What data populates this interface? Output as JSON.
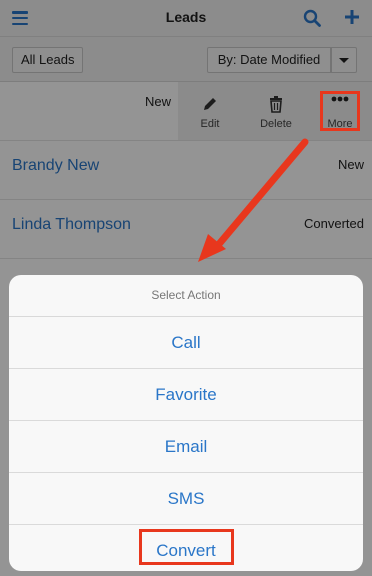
{
  "header": {
    "title": "Leads",
    "menu_icon": "hamburger-icon",
    "search_icon": "search-icon",
    "add_icon": "plus-icon"
  },
  "filterbar": {
    "filter_label": "All Leads",
    "sort_label": "By: Date Modified"
  },
  "rows": [
    {
      "name": "",
      "status": "New"
    },
    {
      "name": "Brandy New",
      "status": "New"
    },
    {
      "name": "Linda Thompson",
      "status": "Converted"
    }
  ],
  "swipe_actions": {
    "edit": "Edit",
    "delete": "Delete",
    "more": "More"
  },
  "action_sheet": {
    "title": "Select Action",
    "options": [
      "Call",
      "Favorite",
      "Email",
      "SMS",
      "Convert"
    ]
  },
  "colors": {
    "accent": "#2a76c8",
    "highlight": "#e8371d"
  }
}
